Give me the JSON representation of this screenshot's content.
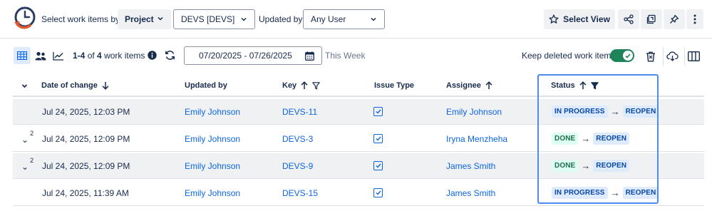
{
  "filters": {
    "select_by_label": "Select work items by:",
    "group_value": "Project",
    "project_value": "DEVS [DEVS]",
    "updated_by_label": "Updated by:",
    "updated_by_value": "Any User"
  },
  "actions": {
    "select_view_label": "Select View"
  },
  "toolbar": {
    "range": "1-4",
    "of_label": "of",
    "total": "4",
    "items_label": "work items",
    "date_range": "07/20/2025 - 07/26/2025",
    "period_label": "This Week",
    "keep_deleted_label": "Keep deleted work items",
    "keep_deleted_on": true
  },
  "table": {
    "columns": {
      "date": "Date of change",
      "updated_by": "Updated by",
      "key": "Key",
      "issue_type": "Issue Type",
      "assignee": "Assignee",
      "status": "Status"
    },
    "rows": [
      {
        "expand": "",
        "count": "",
        "date": "Jul 24, 2025, 12:03 PM",
        "updated_by": "Emily Johnson",
        "key": "DEVS-11",
        "assignee": "Emily Johnson",
        "from": "IN PROGRESS",
        "to": "REOPEN",
        "shaded": true
      },
      {
        "expand": "⌄",
        "count": "2",
        "date": "Jul 24, 2025, 12:09 PM",
        "updated_by": "Emily Johnson",
        "key": "DEVS-3",
        "assignee": "Iryna Menzheha",
        "from": "DONE",
        "to": "REOPEN",
        "shaded": false
      },
      {
        "expand": "⌄",
        "count": "2",
        "date": "Jul 24, 2025, 12:09 PM",
        "updated_by": "Emily Johnson",
        "key": "DEVS-9",
        "assignee": "James Smith",
        "from": "DONE",
        "to": "REOPEN",
        "shaded": true
      },
      {
        "expand": "",
        "count": "",
        "date": "Jul 24, 2025, 11:39 AM",
        "updated_by": "Emily Johnson",
        "key": "DEVS-15",
        "assignee": "James Smith",
        "from": "IN PROGRESS",
        "to": "REOPEN",
        "shaded": false
      }
    ]
  },
  "colors": {
    "accent": "#0c66e4",
    "toggle_on": "#1f845a",
    "highlight": "#4c8cf0",
    "logo_orange": "#e2582c"
  }
}
